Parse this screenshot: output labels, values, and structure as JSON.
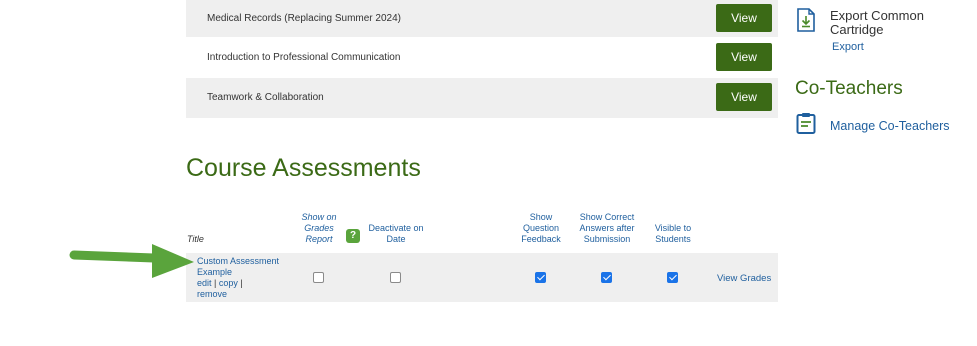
{
  "modules": [
    {
      "title": "Medical Records (Replacing Summer 2024)",
      "button": "View"
    },
    {
      "title": "Introduction to Professional Communication",
      "button": "View"
    },
    {
      "title": "Teamwork & Collaboration",
      "button": "View"
    }
  ],
  "sidebar": {
    "export_title": "Export Common Cartridge",
    "export_link": "Export",
    "coteachers_heading": "Co-Teachers",
    "manage_link": "Manage Co-Teachers"
  },
  "assessments": {
    "heading": "Course Assessments",
    "columns": {
      "title": "Title",
      "show_on_grades": "Show on Grades Report",
      "deactivate": "Deactivate on Date",
      "show_feedback": "Show Question Feedback",
      "show_answers": "Show Correct Answers after Submission",
      "visible": "Visible to Students"
    },
    "rows": [
      {
        "title": "Custom Assessment Example",
        "edit": "edit",
        "copy": "copy",
        "remove": "remove",
        "show_on_grades": false,
        "deactivate": false,
        "show_feedback": true,
        "show_answers": true,
        "visible": true,
        "view_grades": "View Grades"
      }
    ]
  },
  "colors": {
    "accent": "#3b6a16",
    "link": "#1f5f9e",
    "arrow": "#5aa43c"
  }
}
